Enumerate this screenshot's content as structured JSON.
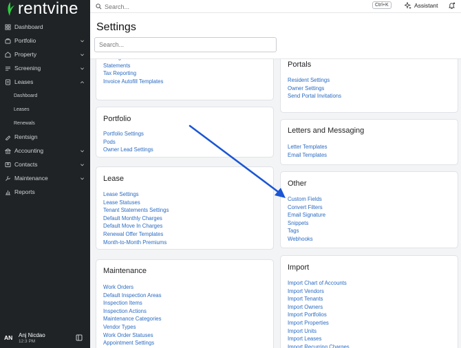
{
  "brand": {
    "name": "rentvine",
    "accent": "#2ecc40"
  },
  "sidebar": {
    "items": [
      {
        "label": "Dashboard",
        "icon": "dashboard-icon",
        "chevron": false
      },
      {
        "label": "Portfolio",
        "icon": "portfolio-icon",
        "chevron": true
      },
      {
        "label": "Property",
        "icon": "property-icon",
        "chevron": true
      },
      {
        "label": "Screening",
        "icon": "screening-icon",
        "chevron": true
      },
      {
        "label": "Leases",
        "icon": "leases-icon",
        "chevron": true,
        "expanded": true
      },
      {
        "label": "Rentsign",
        "icon": "rentsign-icon",
        "chevron": false
      },
      {
        "label": "Accounting",
        "icon": "accounting-icon",
        "chevron": true
      },
      {
        "label": "Contacts",
        "icon": "contacts-icon",
        "chevron": true
      },
      {
        "label": "Maintenance",
        "icon": "maintenance-icon",
        "chevron": true
      },
      {
        "label": "Reports",
        "icon": "reports-icon",
        "chevron": false
      }
    ],
    "leases_sub": [
      "Dashboard",
      "Leases",
      "Renewals"
    ],
    "user": {
      "initials": "AN",
      "name": "Anj Nicdao",
      "time": "12:3 PM"
    }
  },
  "topbar": {
    "search_placeholder": "Search...",
    "shortcut": "Ctrl+K",
    "assistant_label": "Assistant"
  },
  "page": {
    "title": "Settings",
    "search_placeholder": "Search..."
  },
  "left_cards": [
    {
      "title": "",
      "links": [
        "Postings",
        "Statements",
        "Tax Reporting",
        "Invoice Autofill Templates"
      ]
    },
    {
      "title": "Portfolio",
      "links": [
        "Portfolio Settings",
        "Pods",
        "Owner Lead Settings"
      ]
    },
    {
      "title": "Lease",
      "links": [
        "Lease Settings",
        "Lease Statuses",
        "Tenant Statements Settings",
        "Default Monthly Charges",
        "Default Move In Charges",
        "Renewal Offer Templates",
        "Month-to-Month Premiums"
      ]
    },
    {
      "title": "Maintenance",
      "links": [
        "Work Orders",
        "Default Inspection Areas",
        "Inspection Items",
        "Inspection Actions",
        "Maintenance Categories",
        "Vendor Types",
        "Work Order Statuses",
        "Appointment Settings"
      ]
    }
  ],
  "right_cards": [
    {
      "title": "Portals",
      "links": [
        "Resident Settings",
        "Owner Settings",
        "Send Portal Invitations"
      ]
    },
    {
      "title": "Letters and Messaging",
      "links": [
        "Letter Templates",
        "Email Templates"
      ]
    },
    {
      "title": "Other",
      "links": [
        "Custom Fields",
        "Convert Filters",
        "Email Signature",
        "Snippets",
        "Tags",
        "Webhooks"
      ]
    },
    {
      "title": "Import",
      "links": [
        "Import Chart of Accounts",
        "Import Vendors",
        "Import Tenants",
        "Import Owners",
        "Import Portfolios",
        "Import Properties",
        "Import Units",
        "Import Leases",
        "Import Recurring Charges"
      ]
    }
  ],
  "annotation": {
    "arrow_color": "#1a56d6"
  }
}
